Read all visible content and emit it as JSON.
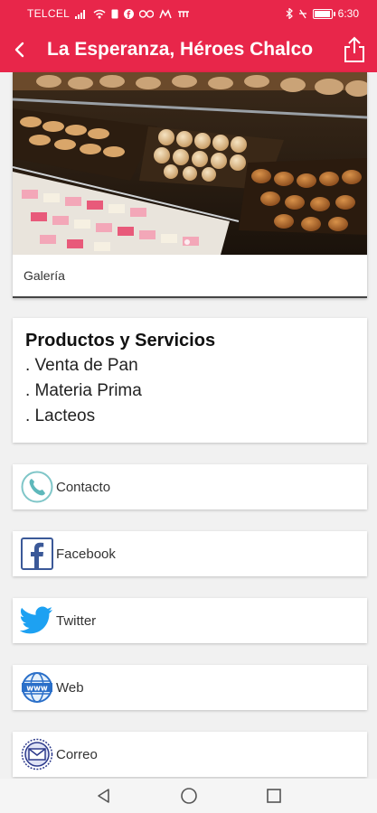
{
  "status_bar": {
    "carrier": "TELCEL",
    "time": "6:30",
    "battery_level": 0.95
  },
  "app_bar": {
    "title": "La Esperanza, Héroes Chalco"
  },
  "gallery": {
    "caption": "Galería"
  },
  "products": {
    "title": "Productos y Servicios",
    "items": [
      ". Venta de Pan",
      ". Materia Prima",
      ". Lacteos"
    ]
  },
  "links": [
    {
      "label": "Contacto",
      "icon": "phone-icon"
    },
    {
      "label": "Facebook",
      "icon": "facebook-icon"
    },
    {
      "label": "Twitter",
      "icon": "twitter-icon"
    },
    {
      "label": "Web",
      "icon": "www-icon"
    },
    {
      "label": "Correo",
      "icon": "mail-icon"
    }
  ],
  "colors": {
    "accent": "#e8264a"
  }
}
